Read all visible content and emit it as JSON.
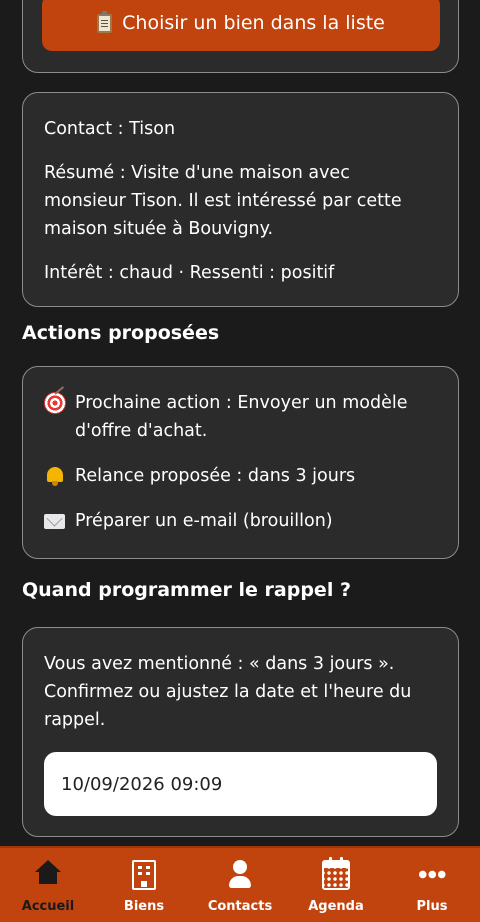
{
  "property_picker": {
    "button_label": "Choisir un bien dans la liste",
    "icon": "clipboard-icon"
  },
  "summary": {
    "contact": "Contact :  Tison",
    "resume": "Résumé : Visite d'une maison avec monsieur Tison. Il est intéressé par cette maison située à Bouvigny.",
    "interest_feeling": "Intérêt : chaud  ·  Ressenti : positif"
  },
  "actions": {
    "title": "Actions proposées",
    "items": [
      {
        "icon": "target-icon",
        "text": "Prochaine action : Envoyer un modèle d'offre d'achat."
      },
      {
        "icon": "bell-icon",
        "text": "Relance proposée : dans 3 jours"
      },
      {
        "icon": "envelope-icon",
        "text": "Préparer un e-mail (brouillon)"
      }
    ]
  },
  "reminder": {
    "title": "Quand programmer le rappel ?",
    "text": "Vous avez mentionné : « dans 3 jours ». Confirmez ou ajustez la date et l'heure du rappel.",
    "datetime_value": "10/09/2026 09:09"
  },
  "nav": {
    "items": [
      {
        "label": "Accueil",
        "icon": "home-icon",
        "active": true
      },
      {
        "label": "Biens",
        "icon": "building-icon",
        "active": false
      },
      {
        "label": "Contacts",
        "icon": "user-icon",
        "active": false
      },
      {
        "label": "Agenda",
        "icon": "calendar-icon",
        "active": false
      },
      {
        "label": "Plus",
        "icon": "more-dots-icon",
        "active": false
      }
    ]
  },
  "colors": {
    "background": "#1b1b1b",
    "card": "#2b2b2b",
    "accent": "#c1440e"
  }
}
